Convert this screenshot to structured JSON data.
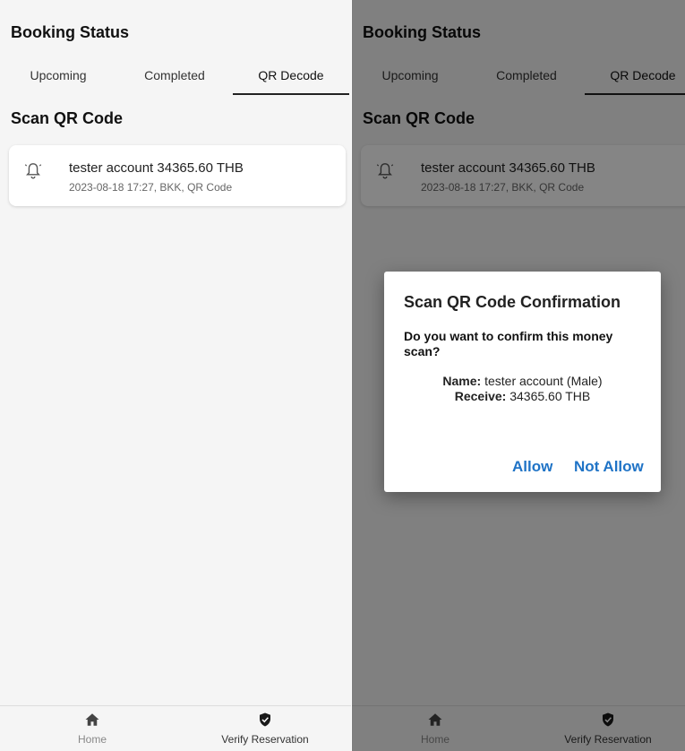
{
  "header": {
    "title": "Booking Status"
  },
  "tabs": [
    {
      "label": "Upcoming"
    },
    {
      "label": "Completed"
    },
    {
      "label": "QR Decode"
    }
  ],
  "section_title": "Scan QR Code",
  "card": {
    "icon": "bell-icon",
    "title": "tester account 34365.60 THB",
    "subtitle": "2023-08-18 17:27, BKK, QR Code"
  },
  "bottom_nav": {
    "home_label": "Home",
    "home_icon": "home-icon",
    "verify_label": "Verify Reservation",
    "verify_icon": "shield-check-icon"
  },
  "dialog": {
    "title": "Scan QR Code Confirmation",
    "question": "Do you want to confirm this money scan?",
    "name_label": "Name:",
    "name_value": "tester account (Male)",
    "receive_label": "Receive:",
    "receive_value": "34365.60 THB",
    "allow_label": "Allow",
    "not_allow_label": "Not Allow"
  },
  "colors": {
    "accent": "#1f73c6",
    "background": "#f5f5f5"
  }
}
